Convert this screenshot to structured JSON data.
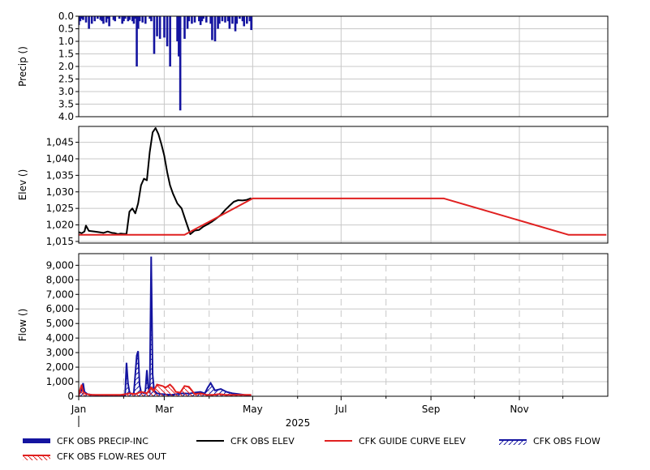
{
  "chart_data": [
    {
      "type": "bar",
      "ylabel": "Precip ()",
      "ylim": [
        0.0,
        4.0
      ],
      "y_inverted": true,
      "yticks": [
        "0.0",
        "0.5",
        "1.0",
        "1.5",
        "2.0",
        "2.5",
        "3.0",
        "3.5",
        "4.0"
      ],
      "grid": true,
      "series": [
        {
          "name": "CFK OBS PRECIP-INC",
          "color": "#1414a0",
          "x": [
            "2025-01-01",
            "2025-01-02",
            "2025-01-03",
            "2025-01-04",
            "2025-01-06",
            "2025-01-08",
            "2025-01-10",
            "2025-01-12",
            "2025-01-14",
            "2025-01-16",
            "2025-01-17",
            "2025-01-18",
            "2025-01-20",
            "2025-01-21",
            "2025-01-22",
            "2025-01-25",
            "2025-01-26",
            "2025-01-29",
            "2025-01-31",
            "2025-02-01",
            "2025-02-02",
            "2025-02-04",
            "2025-02-05",
            "2025-02-07",
            "2025-02-08",
            "2025-02-09",
            "2025-02-10",
            "2025-02-11",
            "2025-02-12",
            "2025-02-14",
            "2025-02-16",
            "2025-02-19",
            "2025-02-20",
            "2025-02-22",
            "2025-02-24",
            "2025-02-26",
            "2025-03-01",
            "2025-03-03",
            "2025-03-05",
            "2025-03-10",
            "2025-03-11",
            "2025-03-12",
            "2025-03-15",
            "2025-03-17",
            "2025-03-18",
            "2025-03-20",
            "2025-03-22",
            "2025-03-25",
            "2025-03-26",
            "2025-03-27",
            "2025-03-28",
            "2025-03-30",
            "2025-04-02",
            "2025-04-03",
            "2025-04-05",
            "2025-04-07",
            "2025-04-08",
            "2025-04-10",
            "2025-04-12",
            "2025-04-14",
            "2025-04-15",
            "2025-04-17",
            "2025-04-19",
            "2025-04-20",
            "2025-04-22",
            "2025-04-24",
            "2025-04-25",
            "2025-04-27",
            "2025-04-29",
            "2025-04-30"
          ],
          "values": [
            0.35,
            0.2,
            0.1,
            0.15,
            0.25,
            0.5,
            0.3,
            0.2,
            0.1,
            0.15,
            0.2,
            0.3,
            0.25,
            0.1,
            0.4,
            0.15,
            0.2,
            0.1,
            0.3,
            0.2,
            0.1,
            0.2,
            0.15,
            0.2,
            0.3,
            0.1,
            2.0,
            0.5,
            0.2,
            0.25,
            0.3,
            0.1,
            0.2,
            1.5,
            0.8,
            0.9,
            0.85,
            1.2,
            2.0,
            1.0,
            1.6,
            3.75,
            0.9,
            0.5,
            0.2,
            0.3,
            0.25,
            0.2,
            0.35,
            0.2,
            0.1,
            0.25,
            0.3,
            0.95,
            1.0,
            0.5,
            0.3,
            0.2,
            0.25,
            0.2,
            0.5,
            0.3,
            0.6,
            0.3,
            0.1,
            0.2,
            0.4,
            0.3,
            0.2,
            0.55
          ]
        }
      ]
    },
    {
      "type": "line",
      "ylabel": "Elev ()",
      "ylim": [
        1014.5,
        1049.8
      ],
      "yticks": [
        "1,015",
        "1,020",
        "1,025",
        "1,030",
        "1,035",
        "1,040",
        "1,045"
      ],
      "grid": true,
      "series": [
        {
          "name": "CFK OBS ELEV",
          "color": "#000000",
          "x": [
            "2025-01-01",
            "2025-01-03",
            "2025-01-05",
            "2025-01-06",
            "2025-01-08",
            "2025-01-12",
            "2025-01-15",
            "2025-01-18",
            "2025-01-21",
            "2025-01-24",
            "2025-01-26",
            "2025-01-28",
            "2025-01-30",
            "2025-02-01",
            "2025-02-03",
            "2025-02-05",
            "2025-02-07",
            "2025-02-09",
            "2025-02-11",
            "2025-02-13",
            "2025-02-15",
            "2025-02-17",
            "2025-02-19",
            "2025-02-21",
            "2025-02-23",
            "2025-02-25",
            "2025-02-27",
            "2025-03-01",
            "2025-03-03",
            "2025-03-05",
            "2025-03-07",
            "2025-03-10",
            "2025-03-13",
            "2025-03-16",
            "2025-03-19",
            "2025-03-22",
            "2025-03-25",
            "2025-03-28",
            "2025-03-31",
            "2025-04-03",
            "2025-04-06",
            "2025-04-09",
            "2025-04-12",
            "2025-04-15",
            "2025-04-18",
            "2025-04-21",
            "2025-04-24",
            "2025-04-27",
            "2025-04-30"
          ],
          "values": [
            1017.8,
            1017.5,
            1018.0,
            1019.8,
            1018.2,
            1018.0,
            1017.8,
            1017.6,
            1018.0,
            1017.6,
            1017.5,
            1017.2,
            1017.4,
            1017.3,
            1017.3,
            1024.0,
            1025.0,
            1023.5,
            1026.5,
            1032.0,
            1034.0,
            1033.5,
            1042.0,
            1048.0,
            1049.3,
            1047.5,
            1044.5,
            1041.0,
            1036.0,
            1032.0,
            1029.5,
            1026.5,
            1025.0,
            1021.0,
            1017.2,
            1018.3,
            1018.5,
            1019.5,
            1020.2,
            1021.0,
            1022.0,
            1023.0,
            1024.5,
            1025.8,
            1027.0,
            1027.5,
            1027.4,
            1027.6,
            1028.1
          ]
        },
        {
          "name": "CFK GUIDE CURVE ELEV",
          "color": "#e02020",
          "x": [
            "2025-01-01",
            "2025-03-15",
            "2025-05-01",
            "2025-09-10",
            "2025-12-05",
            "2025-12-31"
          ],
          "values": [
            1017.0,
            1017.0,
            1028.0,
            1028.0,
            1017.0,
            1017.0
          ]
        }
      ]
    },
    {
      "type": "area",
      "ylabel": "Flow ()",
      "ylim": [
        0,
        9800
      ],
      "yticks": [
        "0",
        "1,000",
        "2,000",
        "3,000",
        "4,000",
        "5,000",
        "6,000",
        "7,000",
        "8,000",
        "9,000"
      ],
      "grid": true,
      "xticks": [
        "Jan",
        "Mar",
        "May",
        "Jul",
        "Sep",
        "Nov"
      ],
      "xlabel_year": "2025",
      "series": [
        {
          "name": "CFK OBS FLOW",
          "color": "#1414a0",
          "x": [
            "2025-01-01",
            "2025-01-03",
            "2025-01-04",
            "2025-01-05",
            "2025-01-07",
            "2025-01-10",
            "2025-01-14",
            "2025-01-18",
            "2025-01-22",
            "2025-01-26",
            "2025-01-30",
            "2025-02-02",
            "2025-02-03",
            "2025-02-04",
            "2025-02-05",
            "2025-02-06",
            "2025-02-08",
            "2025-02-10",
            "2025-02-11",
            "2025-02-12",
            "2025-02-13",
            "2025-02-15",
            "2025-02-16",
            "2025-02-17",
            "2025-02-18",
            "2025-02-19",
            "2025-02-20",
            "2025-02-21",
            "2025-02-22",
            "2025-02-24",
            "2025-02-27",
            "2025-03-02",
            "2025-03-06",
            "2025-03-10",
            "2025-03-14",
            "2025-03-18",
            "2025-03-22",
            "2025-03-26",
            "2025-03-29",
            "2025-03-31",
            "2025-04-02",
            "2025-04-05",
            "2025-04-09",
            "2025-04-13",
            "2025-04-17",
            "2025-04-21",
            "2025-04-25",
            "2025-04-30"
          ],
          "values": [
            100,
            400,
            900,
            300,
            150,
            100,
            80,
            70,
            60,
            50,
            60,
            80,
            2300,
            900,
            300,
            150,
            200,
            2800,
            3100,
            800,
            300,
            200,
            400,
            1800,
            600,
            200,
            9600,
            1500,
            400,
            200,
            150,
            120,
            100,
            150,
            200,
            180,
            250,
            300,
            200,
            600,
            900,
            400,
            500,
            300,
            200,
            150,
            100,
            50
          ]
        },
        {
          "name": "CFK OBS FLOW-RES OUT",
          "color": "#e02020",
          "x": [
            "2025-01-01",
            "2025-01-03",
            "2025-01-04",
            "2025-01-06",
            "2025-01-10",
            "2025-01-15",
            "2025-01-20",
            "2025-01-25",
            "2025-01-30",
            "2025-02-03",
            "2025-02-05",
            "2025-02-09",
            "2025-02-13",
            "2025-02-17",
            "2025-02-20",
            "2025-02-22",
            "2025-02-24",
            "2025-02-26",
            "2025-02-28",
            "2025-03-02",
            "2025-03-05",
            "2025-03-07",
            "2025-03-09",
            "2025-03-12",
            "2025-03-15",
            "2025-03-18",
            "2025-03-22",
            "2025-03-26",
            "2025-03-30",
            "2025-04-04",
            "2025-04-08",
            "2025-04-12",
            "2025-04-16",
            "2025-04-20",
            "2025-04-25",
            "2025-04-30"
          ],
          "values": [
            100,
            800,
            300,
            150,
            100,
            100,
            100,
            100,
            100,
            150,
            200,
            150,
            300,
            200,
            600,
            400,
            800,
            750,
            700,
            600,
            800,
            600,
            300,
            250,
            700,
            650,
            150,
            200,
            100,
            100,
            150,
            100,
            100,
            100,
            100,
            100
          ]
        }
      ]
    }
  ],
  "legend": [
    {
      "label": "CFK OBS PRECIP-INC",
      "style": "thick-bar",
      "color": "#1414a0"
    },
    {
      "label": "CFK OBS ELEV",
      "style": "line",
      "color": "#000000"
    },
    {
      "label": "CFK GUIDE CURVE ELEV",
      "style": "line",
      "color": "#e02020"
    },
    {
      "label": "CFK OBS FLOW",
      "style": "hatch",
      "color": "#1414a0"
    },
    {
      "label": "CFK OBS FLOW-RES OUT",
      "style": "hatch",
      "color": "#e02020"
    }
  ]
}
